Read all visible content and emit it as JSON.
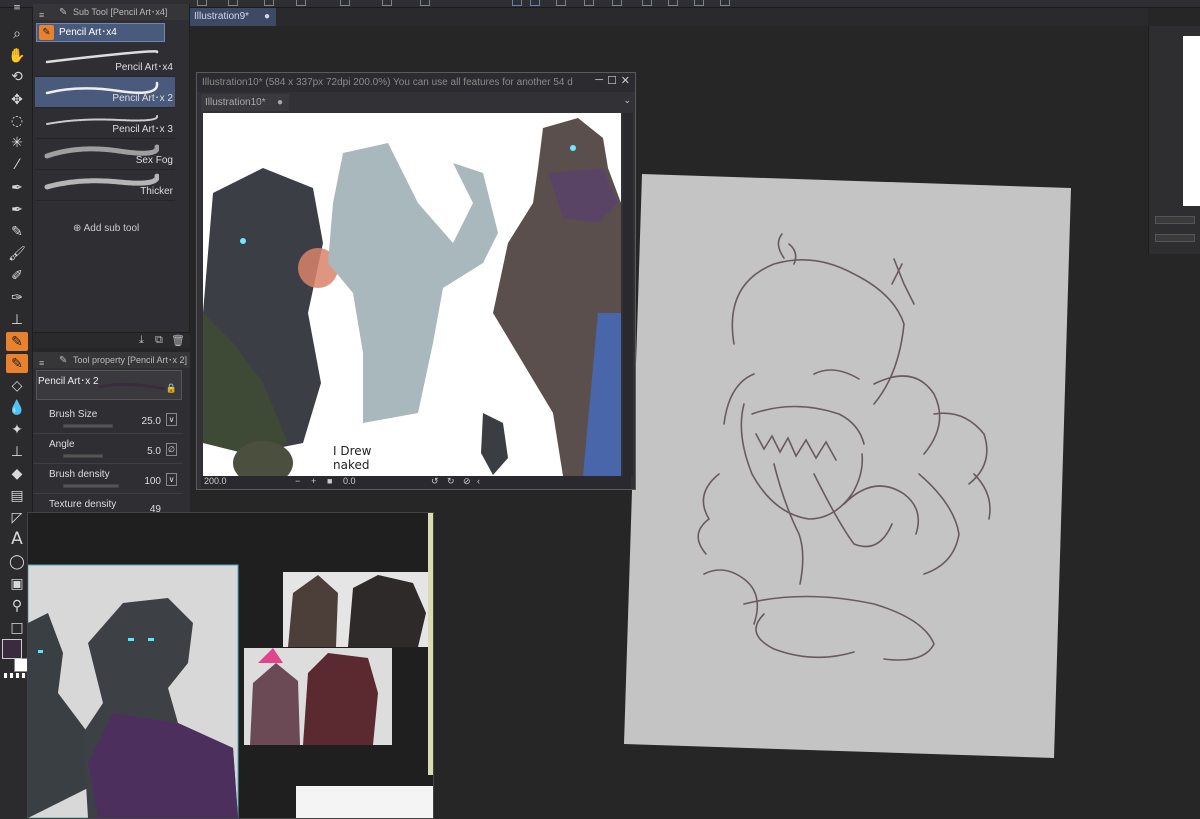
{
  "app": {
    "accent_color": "#e8822e",
    "selection_color": "#4a5a7c"
  },
  "tabs": {
    "main_tab": {
      "label": "Illustration9*",
      "close": "●"
    }
  },
  "subtool_panel": {
    "title": "Sub Tool [Pencil Art･x4]",
    "group_button": "Pencil Art･x4",
    "brushes": [
      {
        "label": "Pencil Art･x4",
        "selected": false
      },
      {
        "label": "Pencil Art･x 2",
        "selected": true
      },
      {
        "label": "Pencil Art･x 3",
        "selected": false
      },
      {
        "label": "Sex Fog",
        "selected": false
      },
      {
        "label": "Thicker",
        "selected": false
      }
    ],
    "add_label": "Add sub tool"
  },
  "toolprop_panel": {
    "title": "Tool property [Pencil Art･x 2]",
    "brush_name": "Pencil Art･x 2",
    "properties": [
      {
        "label": "Brush Size",
        "value": "25.0"
      },
      {
        "label": "Angle",
        "value": "5.0"
      },
      {
        "label": "Brush density",
        "value": "100"
      },
      {
        "label": "Texture density",
        "value": "49"
      }
    ]
  },
  "window10": {
    "title": "Illustration10* (584 x 337px 72dpi 200.0%)  You can use all features for another 54 d",
    "tab": "Illustration10*",
    "tab_close": "●",
    "zoom": "200.0",
    "rotation": "0.0",
    "handwriting": "I Drew\nnaked"
  },
  "icons": {
    "tools": [
      "magnifier-icon",
      "hand-icon",
      "rotate-icon",
      "move-icon",
      "lasso-icon",
      "magic-wand-icon",
      "eyedropper-icon",
      "pen-icon",
      "pen2-icon",
      "pencil-icon",
      "brush-icon",
      "airbrush-icon",
      "decoration-icon",
      "stamp-icon",
      "pencil-active-icon",
      "pencil-active2-icon",
      "eraser-icon",
      "blend-icon",
      "sparkle-icon",
      "stamp2-icon",
      "fill-icon",
      "frame-icon",
      "ruler-icon",
      "text-icon",
      "balloon-icon",
      "gradient-icon",
      "figure-icon",
      "rectangle-icon"
    ]
  }
}
